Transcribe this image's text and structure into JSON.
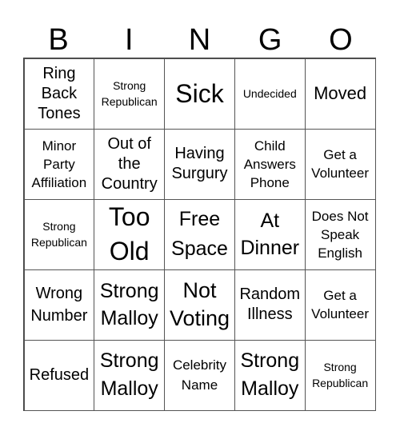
{
  "header": [
    "B",
    "I",
    "N",
    "G",
    "O"
  ],
  "cells": [
    [
      "Ring\nBack\nTones",
      "Strong\nRepublican",
      "Sick",
      "Undecided",
      "Moved"
    ],
    [
      "Minor\nParty\nAffiliation",
      "Out of\nthe\nCountry",
      "Having\nSurgury",
      "Child\nAnswers\nPhone",
      "Get a\nVolunteer"
    ],
    [
      "Strong\nRepublican",
      "Too\nOld",
      "Free\nSpace",
      "At\nDinner",
      "Does Not\nSpeak\nEnglish"
    ],
    [
      "Wrong\nNumber",
      "Strong\nMalloy",
      "Not\nVoting",
      "Random\nIllness",
      "Get a\nVolunteer"
    ],
    [
      "Refused",
      "Strong\nMalloy",
      "Celebrity\nName",
      "Strong\nMalloy",
      "Strong\nRepublican"
    ]
  ]
}
